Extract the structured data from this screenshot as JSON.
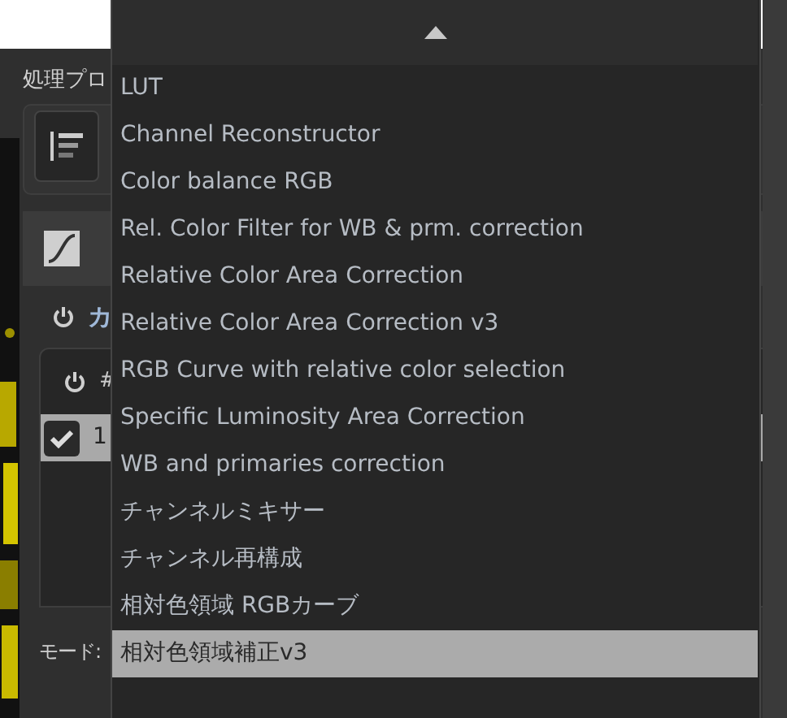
{
  "panel": {
    "title": "処理プロ",
    "section_title": "カ",
    "table": {
      "column_2": "#",
      "rows": [
        {
          "checked": true,
          "number": "1",
          "selected": true
        }
      ]
    },
    "mode_label": "モード:"
  },
  "menu": {
    "items": [
      {
        "label": "LUT",
        "selected": false
      },
      {
        "label": "Channel Reconstructor",
        "selected": false
      },
      {
        "label": "Color balance RGB",
        "selected": false
      },
      {
        "label": "Rel. Color Filter for WB & prm. correction",
        "selected": false
      },
      {
        "label": "Relative Color Area Correction",
        "selected": false
      },
      {
        "label": "Relative Color Area Correction v3",
        "selected": false
      },
      {
        "label": "RGB Curve with relative color selection",
        "selected": false
      },
      {
        "label": "Specific Luminosity Area Correction",
        "selected": false
      },
      {
        "label": "WB and primaries correction",
        "selected": false
      },
      {
        "label": "チャンネルミキサー",
        "selected": false
      },
      {
        "label": "チャンネル再構成",
        "selected": false
      },
      {
        "label": "相対色領域 RGBカーブ",
        "selected": false
      },
      {
        "label": "相対色領域補正v3",
        "selected": true
      }
    ]
  }
}
